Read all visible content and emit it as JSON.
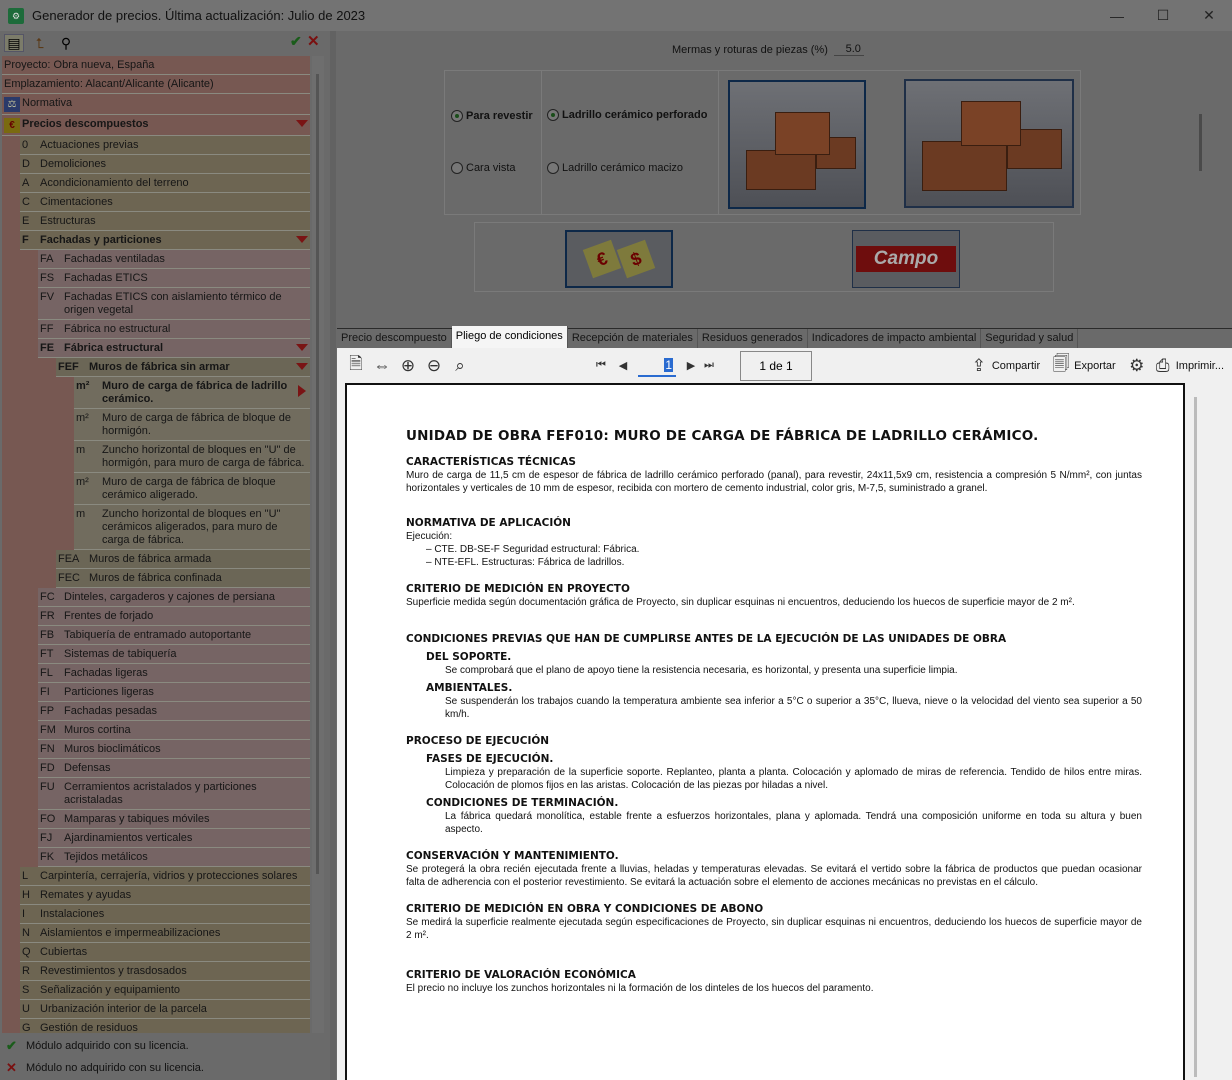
{
  "window": {
    "title": "Generador de precios. Última actualización: Julio de 2023"
  },
  "left": {
    "header_rows": [
      {
        "label": "Proyecto: Obra nueva, España"
      },
      {
        "label": "Emplazamiento: Alacant/Alicante (Alicante)"
      },
      {
        "label": "Normativa"
      },
      {
        "label": "Precios descompuestos"
      }
    ],
    "chapters_before": [
      {
        "code": "0",
        "label": "Actuaciones previas"
      },
      {
        "code": "D",
        "label": "Demoliciones"
      },
      {
        "code": "A",
        "label": "Acondicionamiento del terreno"
      },
      {
        "code": "C",
        "label": "Cimentaciones"
      },
      {
        "code": "E",
        "label": "Estructuras"
      }
    ],
    "chapter_open": {
      "code": "F",
      "label": "Fachadas y particiones"
    },
    "sub_before": [
      {
        "code": "FA",
        "label": "Fachadas ventiladas"
      },
      {
        "code": "FS",
        "label": "Fachadas ETICS"
      },
      {
        "code": "FV",
        "label": "Fachadas ETICS con aislamiento térmico de origen vegetal"
      },
      {
        "code": "FF",
        "label": "Fábrica no estructural"
      }
    ],
    "sub_open": {
      "code": "FE",
      "label": "Fábrica estructural"
    },
    "group_open": {
      "code": "FEF",
      "label": "Muros de fábrica sin armar"
    },
    "units": [
      {
        "code": "m²",
        "label": "Muro de carga de fábrica de ladrillo cerámico."
      },
      {
        "code": "m²",
        "label": "Muro de carga de fábrica de bloque de hormigón."
      },
      {
        "code": "m",
        "label": "Zuncho horizontal de bloques en \"U\" de hormigón, para muro de carga de fábrica."
      },
      {
        "code": "m²",
        "label": "Muro de carga de fábrica de bloque cerámico aligerado."
      },
      {
        "code": "m",
        "label": "Zuncho horizontal de bloques en \"U\" cerámicos aligerados, para muro de carga de fábrica."
      }
    ],
    "groups_after": [
      {
        "code": "FEA",
        "label": "Muros de fábrica armada"
      },
      {
        "code": "FEC",
        "label": "Muros de fábrica confinada"
      }
    ],
    "sub_after": [
      {
        "code": "FC",
        "label": "Dinteles, cargaderos y cajones de persiana"
      },
      {
        "code": "FR",
        "label": "Frentes de forjado"
      },
      {
        "code": "FB",
        "label": "Tabiquería de entramado autoportante"
      },
      {
        "code": "FT",
        "label": "Sistemas de tabiquería"
      },
      {
        "code": "FL",
        "label": "Fachadas ligeras"
      },
      {
        "code": "FI",
        "label": "Particiones ligeras"
      },
      {
        "code": "FP",
        "label": "Fachadas pesadas"
      },
      {
        "code": "FM",
        "label": "Muros cortina"
      },
      {
        "code": "FN",
        "label": "Muros bioclimáticos"
      },
      {
        "code": "FD",
        "label": "Defensas"
      },
      {
        "code": "FU",
        "label": "Cerramientos acristalados y particiones acristaladas"
      },
      {
        "code": "FO",
        "label": "Mamparas y tabiques móviles"
      },
      {
        "code": "FJ",
        "label": "Ajardinamientos verticales"
      },
      {
        "code": "FK",
        "label": "Tejidos metálicos"
      }
    ],
    "chapters_after": [
      {
        "code": "L",
        "label": "Carpintería, cerrajería, vidrios y protecciones solares"
      },
      {
        "code": "H",
        "label": "Remates y ayudas"
      },
      {
        "code": "I",
        "label": "Instalaciones"
      },
      {
        "code": "N",
        "label": "Aislamientos e impermeabilizaciones"
      },
      {
        "code": "Q",
        "label": "Cubiertas"
      },
      {
        "code": "R",
        "label": "Revestimientos y trasdosados"
      },
      {
        "code": "S",
        "label": "Señalización y equipamiento"
      },
      {
        "code": "U",
        "label": "Urbanización interior de la parcela"
      },
      {
        "code": "G",
        "label": "Gestión de residuos"
      }
    ],
    "legend": {
      "acquired": "Módulo adquirido con su licencia.",
      "not_acquired": "Módulo no adquirido con su licencia."
    }
  },
  "options": {
    "mermas_label": "Mermas y roturas de piezas (%)",
    "mermas_value": "5.0",
    "finish": [
      {
        "label": "Para revestir",
        "selected": true
      },
      {
        "label": "Cara vista",
        "selected": false
      }
    ],
    "brick": [
      {
        "label": "Ladrillo cerámico perforado",
        "selected": true
      },
      {
        "label": "Ladrillo cerámico macizo",
        "selected": false
      }
    ],
    "campo_logo": "Campo"
  },
  "tabs": [
    {
      "label": "Precio descompuesto"
    },
    {
      "label": "Pliego de condiciones",
      "active": true
    },
    {
      "label": "Recepción de materiales"
    },
    {
      "label": "Residuos generados"
    },
    {
      "label": "Indicadores de impacto ambiental"
    },
    {
      "label": "Seguridad y salud"
    }
  ],
  "viewer": {
    "page": "1",
    "page_of": "1 de 1",
    "share": "Compartir",
    "export": "Exportar",
    "print": "Imprimir..."
  },
  "doc": {
    "title": "UNIDAD DE OBRA FEF010: MURO DE CARGA DE FÁBRICA DE LADRILLO CERÁMICO.",
    "caract_h": "CARACTERÍSTICAS TÉCNICAS",
    "caract_p": "Muro de carga de 11,5 cm de espesor de fábrica de ladrillo cerámico perforado (panal), para revestir, 24x11,5x9 cm, resistencia a compresión 5 N/mm², con juntas horizontales y verticales de 10 mm de espesor, recibida con mortero de cemento industrial, color gris, M-7,5, suministrado a granel.",
    "norm_h": "NORMATIVA DE APLICACIÓN",
    "norm_sub": "Ejecución:",
    "norm_items": [
      "– CTE. DB-SE-F Seguridad estructural: Fábrica.",
      "– NTE-EFL. Estructuras: Fábrica de ladrillos."
    ],
    "medproy_h": "CRITERIO DE MEDICIÓN EN PROYECTO",
    "medproy_p": "Superficie medida según documentación gráfica de Proyecto, sin duplicar esquinas ni encuentros, deduciendo los huecos de superficie mayor de 2 m².",
    "cond_h": "CONDICIONES PREVIAS QUE HAN DE CUMPLIRSE ANTES DE LA EJECUCIÓN DE LAS UNIDADES DE OBRA",
    "soporte_h": "DEL SOPORTE.",
    "soporte_p": "Se comprobará que el plano de apoyo tiene la resistencia necesaria, es horizontal, y presenta una superficie limpia.",
    "amb_h": "AMBIENTALES.",
    "amb_p": "Se suspenderán los trabajos cuando la temperatura ambiente sea inferior a 5°C o superior a 35°C, llueva, nieve o la velocidad del viento sea superior a 50 km/h.",
    "proc_h": "PROCESO DE EJECUCIÓN",
    "fases_h": "FASES DE EJECUCIÓN.",
    "fases_p": "Limpieza y preparación de la superficie soporte. Replanteo, planta a planta. Colocación y aplomado de miras de referencia. Tendido de hilos entre miras. Colocación de plomos fijos en las aristas. Colocación de las piezas por hiladas a nivel.",
    "term_h": "CONDICIONES DE TERMINACIÓN.",
    "term_p": "La fábrica quedará monolítica, estable frente a esfuerzos horizontales, plana y aplomada. Tendrá una composición uniforme en toda su altura y buen aspecto.",
    "cons_h": "CONSERVACIÓN Y MANTENIMIENTO.",
    "cons_p": "Se protegerá la obra recién ejecutada frente a lluvias, heladas y temperaturas elevadas. Se evitará el vertido sobre la fábrica de productos que puedan ocasionar falta de adherencia con el posterior revestimiento. Se evitará la actuación sobre el elemento de acciones mecánicas no previstas en el cálculo.",
    "medobra_h": "CRITERIO DE MEDICIÓN EN OBRA Y CONDICIONES DE ABONO",
    "medobra_p": "Se medirá la superficie realmente ejecutada según especificaciones de Proyecto, sin duplicar esquinas ni encuentros, deduciendo los huecos de superficie mayor de 2 m².",
    "valor_h": "CRITERIO DE VALORACIÓN ECONÓMICA",
    "valor_p": "El precio no incluye los zunchos horizontales ni la formación de los dinteles de los huecos del paramento."
  }
}
